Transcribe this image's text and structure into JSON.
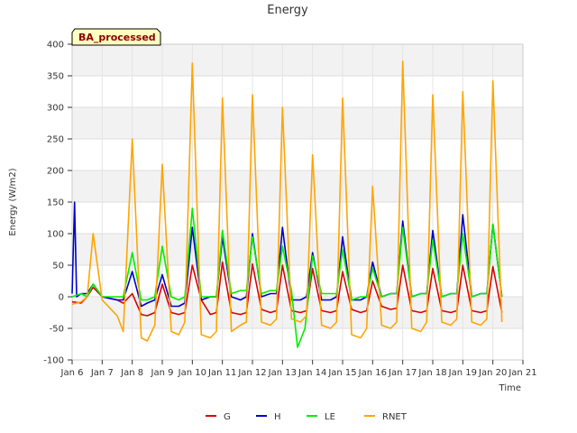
{
  "chart_data": {
    "type": "line",
    "title": "Energy",
    "xlabel": "Time",
    "ylabel": "Energy (W/m2)",
    "badge": "BA_processed",
    "xlim": [
      6,
      21
    ],
    "ylim": [
      -100,
      400
    ],
    "x_ticks": [
      6,
      7,
      8,
      9,
      10,
      11,
      12,
      13,
      14,
      15,
      16,
      17,
      18,
      19,
      20,
      21
    ],
    "x_tick_labels": [
      "Jan 6",
      "Jan 7",
      "Jan 8",
      "Jan 9",
      "Jan 10",
      "Jan 11",
      "Jan 12",
      "Jan 13",
      "Jan 14",
      "Jan 15",
      "Jan 16",
      "Jan 17",
      "Jan 18",
      "Jan 19",
      "Jan 20",
      "Jan 21"
    ],
    "y_ticks": [
      -100,
      -50,
      0,
      50,
      100,
      150,
      200,
      250,
      300,
      350,
      400
    ],
    "grid": true,
    "legend_position": "bottom",
    "series": [
      {
        "name": "G",
        "color": "#dd0000",
        "x": [
          6.0,
          6.3,
          6.5,
          6.7,
          7.0,
          7.5,
          7.7,
          8.0,
          8.3,
          8.5,
          8.75,
          9.0,
          9.3,
          9.55,
          9.75,
          10.0,
          10.3,
          10.6,
          10.8,
          11.0,
          11.3,
          11.6,
          11.8,
          12.0,
          12.3,
          12.6,
          12.8,
          13.0,
          13.3,
          13.6,
          13.8,
          14.0,
          14.3,
          14.6,
          14.8,
          15.0,
          15.3,
          15.6,
          15.8,
          16.0,
          16.3,
          16.6,
          16.8,
          17.0,
          17.3,
          17.6,
          17.8,
          18.0,
          18.3,
          18.6,
          18.8,
          19.0,
          19.3,
          19.6,
          19.8,
          20.0,
          20.3
        ],
        "y": [
          -8,
          -10,
          0,
          15,
          0,
          -5,
          -10,
          5,
          -28,
          -30,
          -25,
          20,
          -25,
          -28,
          -25,
          50,
          -5,
          -28,
          -25,
          55,
          -25,
          -28,
          -25,
          52,
          -20,
          -25,
          -22,
          50,
          -22,
          -25,
          -22,
          45,
          -22,
          -25,
          -22,
          40,
          -20,
          -25,
          -22,
          25,
          -15,
          -20,
          -18,
          50,
          -22,
          -25,
          -22,
          45,
          -22,
          -25,
          -22,
          50,
          -22,
          -25,
          -22,
          48,
          -25
        ]
      },
      {
        "name": "H",
        "color": "#0000cc",
        "x": [
          6.0,
          6.08,
          6.15,
          6.3,
          6.5,
          6.7,
          7.0,
          7.5,
          7.7,
          8.0,
          8.3,
          8.5,
          8.75,
          9.0,
          9.3,
          9.55,
          9.75,
          10.0,
          10.3,
          10.6,
          10.8,
          11.0,
          11.3,
          11.6,
          11.8,
          12.0,
          12.3,
          12.6,
          12.8,
          13.0,
          13.3,
          13.6,
          13.8,
          14.0,
          14.3,
          14.6,
          14.8,
          15.0,
          15.3,
          15.6,
          15.8,
          16.0,
          16.3,
          16.6,
          16.8,
          17.0,
          17.3,
          17.6,
          17.8,
          18.0,
          18.3,
          18.6,
          18.8,
          19.0,
          19.3,
          19.6,
          19.8,
          20.0,
          20.3
        ],
        "y": [
          5,
          150,
          0,
          5,
          5,
          20,
          0,
          -5,
          -5,
          40,
          -15,
          -10,
          -5,
          35,
          -15,
          -15,
          -10,
          110,
          -5,
          0,
          0,
          95,
          0,
          -5,
          0,
          100,
          0,
          5,
          5,
          110,
          -5,
          -5,
          0,
          70,
          -5,
          -5,
          0,
          95,
          -5,
          -5,
          0,
          55,
          0,
          5,
          5,
          120,
          0,
          5,
          5,
          105,
          0,
          5,
          5,
          130,
          0,
          5,
          5,
          115,
          0
        ]
      },
      {
        "name": "LE",
        "color": "#00ee00",
        "x": [
          6.0,
          6.3,
          6.5,
          6.7,
          7.0,
          7.5,
          7.7,
          8.0,
          8.3,
          8.5,
          8.75,
          9.0,
          9.3,
          9.55,
          9.75,
          10.0,
          10.3,
          10.6,
          10.8,
          11.0,
          11.3,
          11.6,
          11.8,
          12.0,
          12.3,
          12.6,
          12.8,
          13.0,
          13.3,
          13.5,
          13.75,
          14.0,
          14.3,
          14.6,
          14.8,
          15.0,
          15.3,
          15.6,
          15.8,
          16.0,
          16.3,
          16.6,
          16.8,
          17.0,
          17.3,
          17.6,
          17.8,
          18.0,
          18.3,
          18.6,
          18.8,
          19.0,
          19.3,
          19.6,
          19.8,
          20.0,
          20.3
        ],
        "y": [
          0,
          5,
          0,
          20,
          0,
          0,
          0,
          70,
          -5,
          -5,
          0,
          80,
          0,
          -5,
          0,
          140,
          0,
          0,
          0,
          105,
          5,
          10,
          10,
          95,
          5,
          10,
          10,
          80,
          10,
          -80,
          -50,
          65,
          5,
          5,
          5,
          75,
          -5,
          0,
          0,
          45,
          0,
          5,
          5,
          110,
          0,
          5,
          5,
          90,
          0,
          5,
          5,
          100,
          0,
          5,
          5,
          115,
          0
        ]
      },
      {
        "name": "RNET",
        "color": "#ffa500",
        "x": [
          6.0,
          6.3,
          6.5,
          6.7,
          7.0,
          7.5,
          7.7,
          8.0,
          8.3,
          8.5,
          8.75,
          9.0,
          9.3,
          9.55,
          9.75,
          10.0,
          10.3,
          10.6,
          10.8,
          11.0,
          11.3,
          11.6,
          11.8,
          12.0,
          12.3,
          12.6,
          12.8,
          13.0,
          13.3,
          13.6,
          13.8,
          14.0,
          14.3,
          14.6,
          14.8,
          15.0,
          15.3,
          15.6,
          15.8,
          16.0,
          16.3,
          16.6,
          16.8,
          17.0,
          17.3,
          17.6,
          17.8,
          18.0,
          18.3,
          18.6,
          18.8,
          19.0,
          19.3,
          19.6,
          19.8,
          20.0,
          20.3
        ],
        "y": [
          -12,
          -8,
          0,
          100,
          -5,
          -30,
          -55,
          250,
          -65,
          -70,
          -45,
          210,
          -55,
          -60,
          -40,
          370,
          -60,
          -65,
          -55,
          315,
          -55,
          -45,
          -40,
          320,
          -40,
          -45,
          -35,
          300,
          -35,
          -40,
          -30,
          225,
          -45,
          -50,
          -40,
          315,
          -60,
          -65,
          -50,
          175,
          -45,
          -50,
          -40,
          373,
          -50,
          -55,
          -40,
          320,
          -40,
          -45,
          -35,
          325,
          -40,
          -45,
          -35,
          342,
          -40
        ]
      }
    ]
  }
}
